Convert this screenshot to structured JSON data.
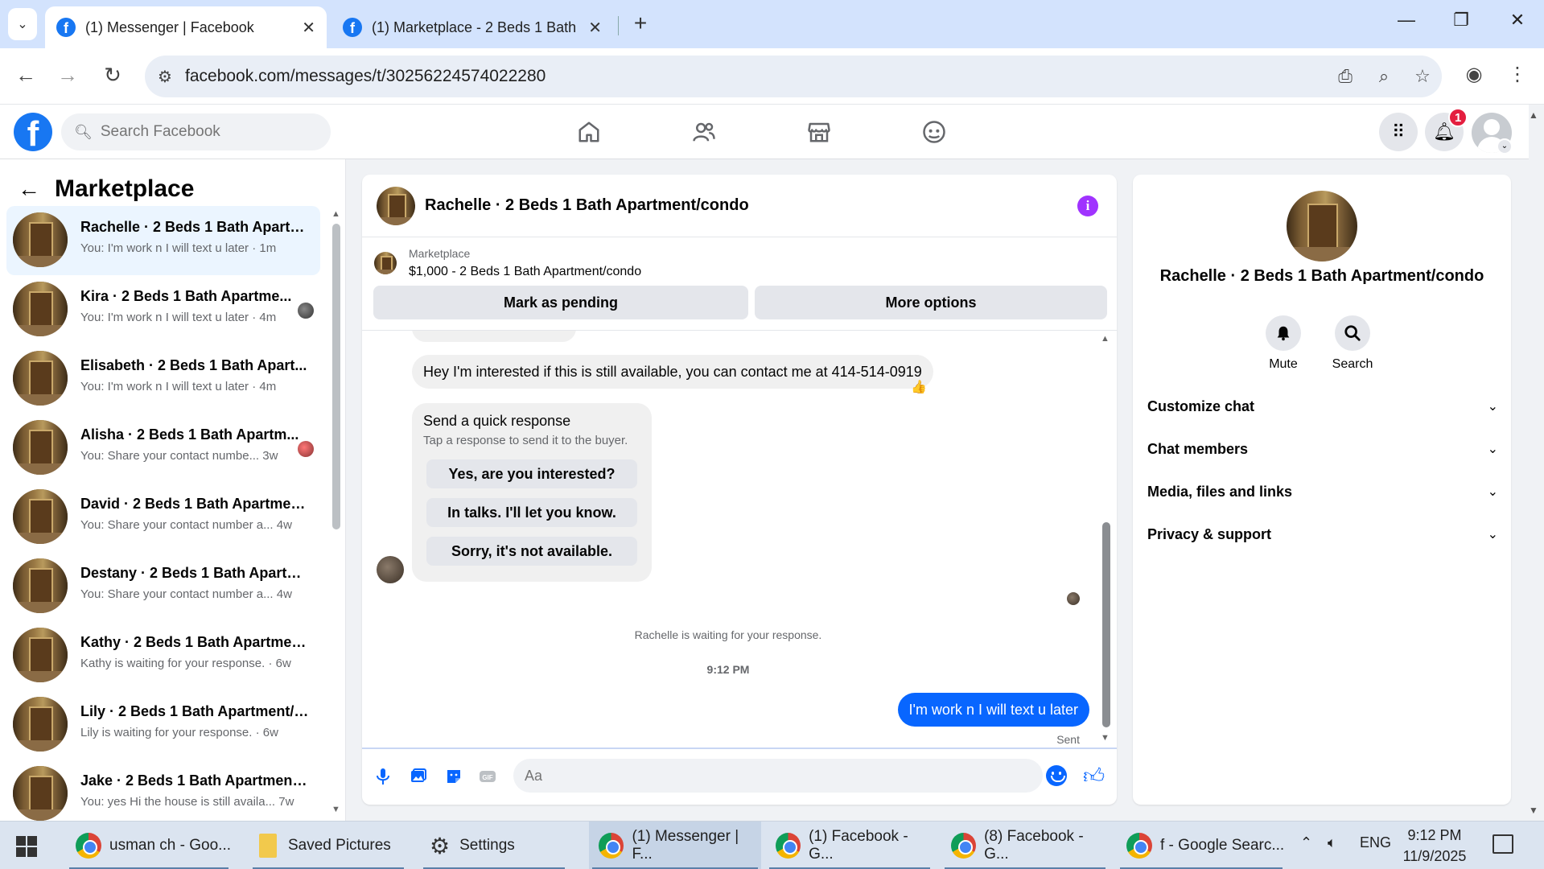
{
  "browser": {
    "tabs": [
      {
        "title": "(1) Messenger | Facebook",
        "active": true
      },
      {
        "title": "(1) Marketplace - 2 Beds 1 Bath",
        "active": false
      }
    ],
    "url": "facebook.com/messages/t/30256224574022280"
  },
  "fb_header": {
    "search_placeholder": "Search Facebook",
    "notification_count": "1"
  },
  "marketplace": {
    "title": "Marketplace",
    "conversations": [
      {
        "name": "Rachelle · 2 Beds 1 Bath Apartm...",
        "snippet": "You: I'm work n I will text u later · 1m",
        "active": true,
        "seen": "none"
      },
      {
        "name": "Kira · 2 Beds 1 Bath Apartme...",
        "snippet": "You: I'm work n I will text u later · 4m",
        "active": false,
        "seen": "dark"
      },
      {
        "name": "Elisabeth · 2 Beds 1 Bath Apart...",
        "snippet": "You: I'm work n I will text u later · 4m",
        "active": false,
        "seen": "none"
      },
      {
        "name": "Alisha · 2 Beds 1 Bath Apartm...",
        "snippet": "You: Share your contact numbe... 3w",
        "active": false,
        "seen": "red"
      },
      {
        "name": "David · 2 Beds 1 Bath Apartmen...",
        "snippet": "You: Share your contact number a... 4w",
        "active": false,
        "seen": "none"
      },
      {
        "name": "Destany · 2 Beds 1 Bath Apartm...",
        "snippet": "You: Share your contact number a... 4w",
        "active": false,
        "seen": "none"
      },
      {
        "name": "Kathy · 2 Beds 1 Bath Apartmen...",
        "snippet": "Kathy is waiting for your response. · 6w",
        "active": false,
        "seen": "none"
      },
      {
        "name": "Lily · 2 Beds 1 Bath Apartment/c...",
        "snippet": "Lily is waiting for your response. · 6w",
        "active": false,
        "seen": "none"
      },
      {
        "name": "Jake · 2 Beds 1 Bath Apartment/...",
        "snippet": "You: yes Hi the house is still availa... 7w",
        "active": false,
        "seen": "none"
      }
    ]
  },
  "chat": {
    "title": "Rachelle · 2 Beds 1 Bath Apartment/condo",
    "listing_label": "Marketplace",
    "listing_sub": "$1,000 - 2 Beds 1 Bath Apartment/condo",
    "mark_pending": "Mark as pending",
    "more_options": "More options",
    "incoming_message": "Hey I'm interested if this is still available,  you can contact me at 414-514-0919",
    "reaction": "👍",
    "quick_title": "Send a quick response",
    "quick_sub": "Tap a response to send it to the buyer.",
    "quick_responses": [
      "Yes, are you interested?",
      "In talks. I'll let you know.",
      "Sorry, it's not available."
    ],
    "waiting_text": "Rachelle is waiting for your response.",
    "timestamp": "9:12 PM",
    "outgoing_message": "I'm work n I will text u later",
    "sent_label": "Sent",
    "composer_placeholder": "Aa"
  },
  "right_panel": {
    "name": "Rachelle · 2 Beds 1 Bath Apartment/condo",
    "actions": [
      "Mute",
      "Search"
    ],
    "sections": [
      "Customize chat",
      "Chat members",
      "Media, files and links",
      "Privacy & support"
    ]
  },
  "taskbar": {
    "items": [
      {
        "label": "usman ch - Goo...",
        "icon": "chrome-icon",
        "active": false
      },
      {
        "label": "Saved Pictures",
        "icon": "folder-icon",
        "active": false
      },
      {
        "label": "Settings",
        "icon": "gear-icon",
        "active": false
      },
      {
        "label": "(1) Messenger | F...",
        "icon": "chrome-icon",
        "active": true
      },
      {
        "label": "(1) Facebook - G...",
        "icon": "chrome-icon",
        "active": false
      },
      {
        "label": "(8) Facebook - G...",
        "icon": "chrome-icon",
        "active": false
      },
      {
        "label": "f - Google Searc...",
        "icon": "chrome-icon",
        "active": false
      }
    ],
    "language": "ENG",
    "time": "9:12 PM",
    "date": "11/9/2025"
  }
}
